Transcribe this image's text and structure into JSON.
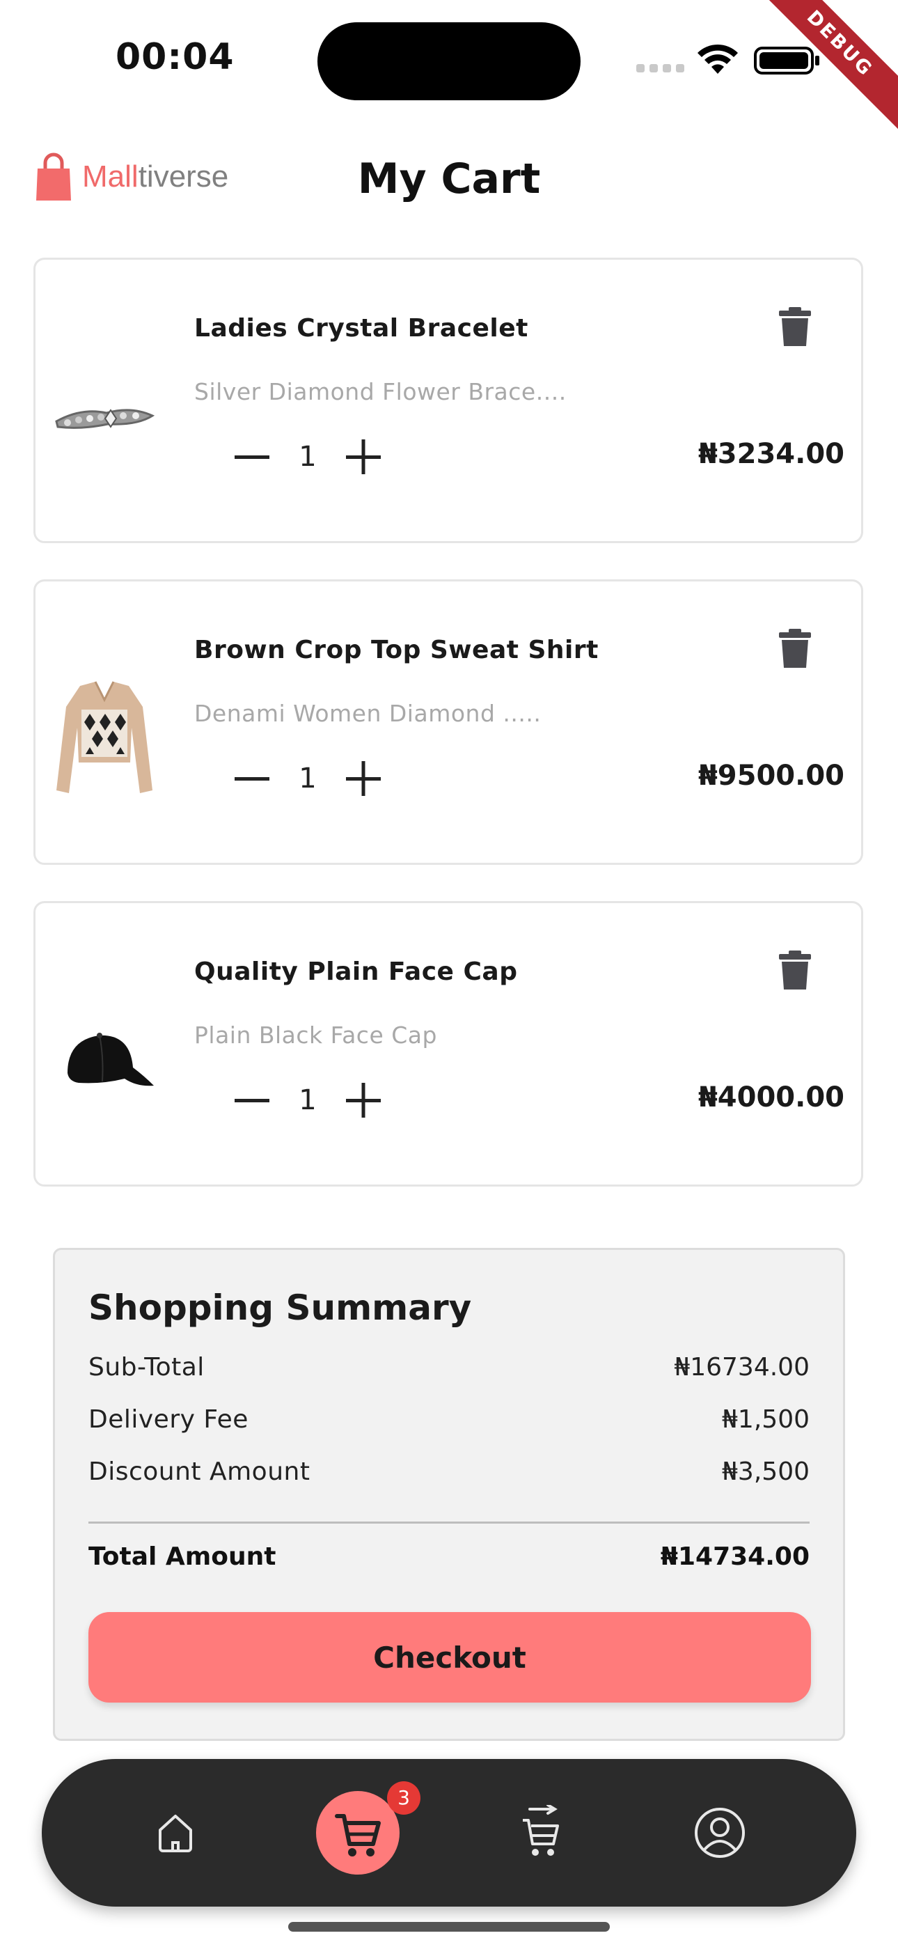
{
  "status_bar": {
    "time": "00:04",
    "debug_label": "DEBUG"
  },
  "header": {
    "logo_accent": "Mall",
    "logo_rest": "tiverse",
    "title": "My Cart"
  },
  "cart": {
    "items": [
      {
        "name": "Ladies Crystal Bracelet",
        "description": "Silver Diamond Flower Brace....",
        "quantity": "1",
        "price": "₦3234.00"
      },
      {
        "name": "Brown Crop Top Sweat Shirt",
        "description": "Denami Women Diamond .....",
        "quantity": "1",
        "price": "₦9500.00"
      },
      {
        "name": "Quality Plain Face Cap",
        "description": "Plain Black Face Cap",
        "quantity": "1",
        "price": "₦4000.00"
      }
    ]
  },
  "summary": {
    "title": "Shopping Summary",
    "subtotal_label": "Sub-Total",
    "subtotal_value": "₦16734.00",
    "delivery_label": "Delivery Fee",
    "delivery_value": "₦1,500",
    "discount_label": "Discount Amount",
    "discount_value": "₦3,500",
    "total_label": "Total Amount",
    "total_value": "₦14734.00",
    "checkout_label": "Checkout"
  },
  "bottom_nav": {
    "items": [
      {
        "icon": "home-icon"
      },
      {
        "icon": "cart-icon",
        "active": true
      },
      {
        "icon": "order-history-icon"
      },
      {
        "icon": "profile-icon"
      }
    ],
    "cart_badge": "3"
  },
  "colors": {
    "accent": "#ff7b7b",
    "logo_red": "#f06a6a",
    "nav_background": "#2b2b2b",
    "badge": "#e53935",
    "summary_background": "#f2f2f2",
    "muted_text": "#a8a8a8"
  }
}
